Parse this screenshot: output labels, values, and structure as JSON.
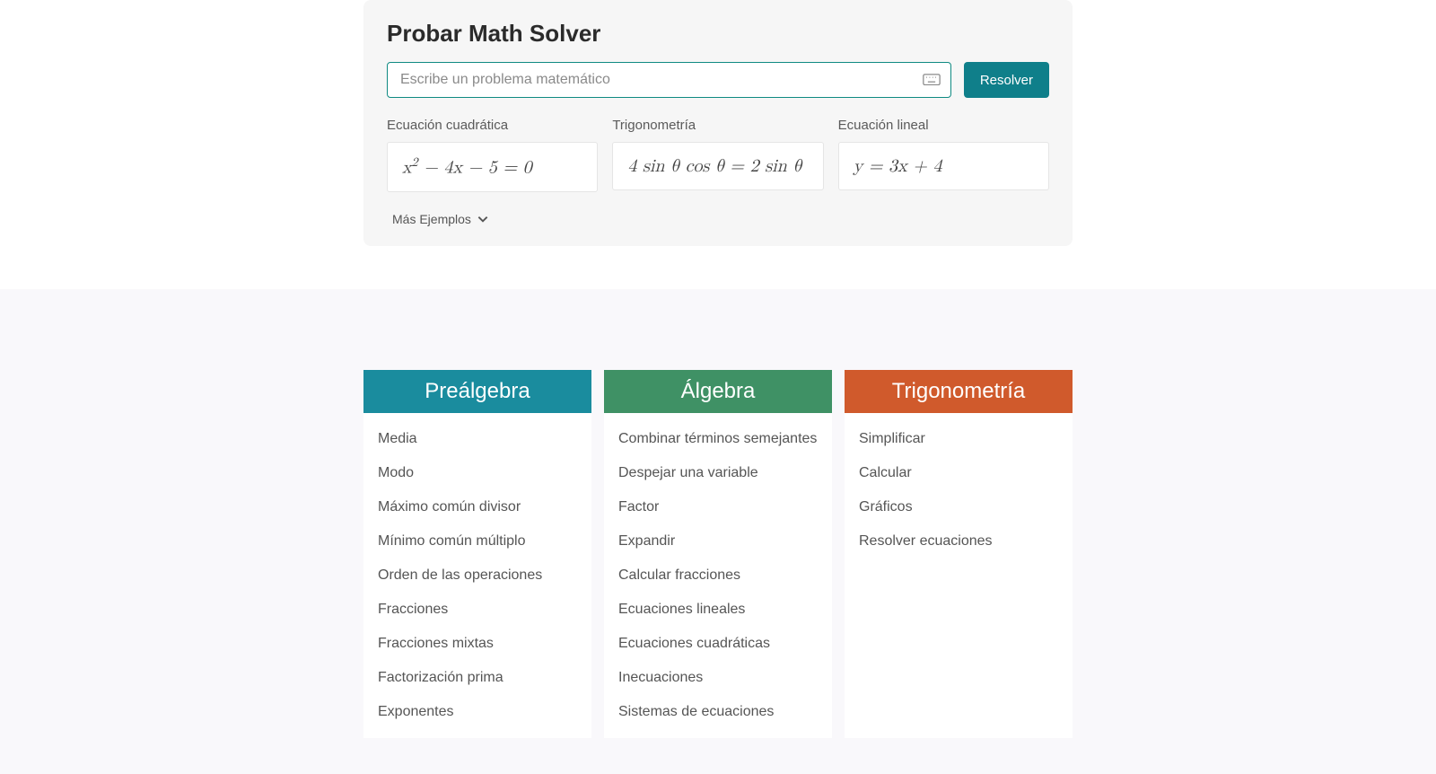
{
  "solver": {
    "title": "Probar Math Solver",
    "input_placeholder": "Escribe un problema matemático",
    "solve_label": "Resolver",
    "more_examples_label": "Más Ejemplos",
    "examples": [
      {
        "label": "Ecuación cuadrática",
        "expr": "x² − 4x − 5 = 0"
      },
      {
        "label": "Trigonometría",
        "expr": "4 sin θ cos θ = 2 sin θ"
      },
      {
        "label": "Ecuación lineal",
        "expr": "y = 3x + 4"
      }
    ]
  },
  "categories": [
    {
      "title": "Preálgebra",
      "color": "teal",
      "items": [
        "Media",
        "Modo",
        "Máximo común divisor",
        "Mínimo común múltiplo",
        "Orden de las operaciones",
        "Fracciones",
        "Fracciones mixtas",
        "Factorización prima",
        "Exponentes"
      ]
    },
    {
      "title": "Álgebra",
      "color": "green",
      "items": [
        "Combinar términos semejantes",
        "Despejar una variable",
        "Factor",
        "Expandir",
        "Calcular fracciones",
        "Ecuaciones lineales",
        "Ecuaciones cuadráticas",
        "Inecuaciones",
        "Sistemas de ecuaciones"
      ]
    },
    {
      "title": "Trigonometría",
      "color": "orange",
      "items": [
        "Simplificar",
        "Calcular",
        "Gráficos",
        "Resolver ecuaciones"
      ]
    }
  ]
}
